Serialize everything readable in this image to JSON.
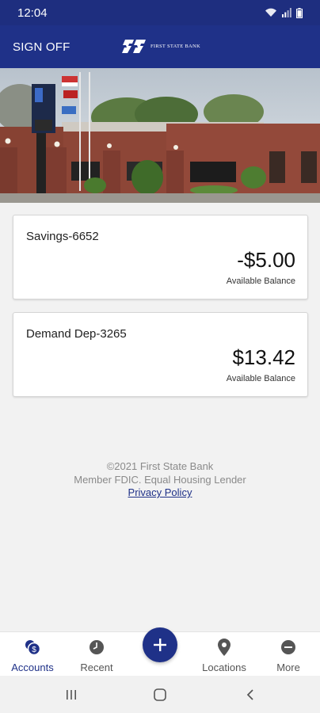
{
  "status_bar": {
    "time": "12:04"
  },
  "header": {
    "sign_off_label": "SIGN OFF",
    "brand_name": "FIRST STATE BANK"
  },
  "accounts": [
    {
      "name": "Savings-6652",
      "balance": "-$5.00",
      "caption": "Available Balance"
    },
    {
      "name": "Demand Dep-3265",
      "balance": "$13.42",
      "caption": "Available Balance"
    }
  ],
  "footer": {
    "copyright": "©2021 First State Bank",
    "fdic": "Member FDIC. Equal Housing Lender",
    "privacy_link": "Privacy Policy"
  },
  "bottom_nav": {
    "accounts": "Accounts",
    "recent": "Recent",
    "locations": "Locations",
    "more": "More",
    "active": "accounts"
  },
  "colors": {
    "brand": "#1f3188",
    "status_bar": "#1e2e7f",
    "background": "#f2f2f2"
  }
}
